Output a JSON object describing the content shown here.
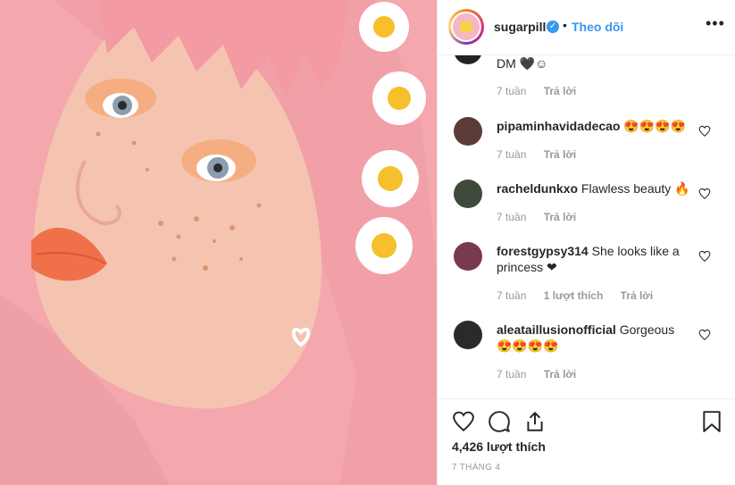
{
  "post": {
    "username": "sugarpill",
    "follow_label": "Theo dõi",
    "separator": "•",
    "verified_icon": "verified-badge-icon",
    "more_icon": "more-options-icon",
    "more_label": "•••",
    "photo_alt": "sugarpill"
  },
  "comments": [
    {
      "user": "",
      "text": "DM 🖤☺",
      "time": "7 tuần",
      "likes": "",
      "reply": "Trả lời",
      "avatar_color": "#222222"
    },
    {
      "user": "pipaminhavidadecao",
      "text": "😍😍😍😍",
      "time": "7 tuần",
      "likes": "",
      "reply": "Trả lời",
      "avatar_color": "#5a3b35"
    },
    {
      "user": "racheldunkxo",
      "text": "Flawless beauty 🔥",
      "time": "7 tuần",
      "likes": "",
      "reply": "Trả lời",
      "avatar_color": "#3f4a3a"
    },
    {
      "user": "forestgypsy314",
      "text": "She looks like a princess ❤",
      "time": "7 tuần",
      "likes": "1 lượt thích",
      "reply": "Trả lời",
      "avatar_color": "#7a3a4e"
    },
    {
      "user": "aleataillusionofficial",
      "text": "Gorgeous 😍😍😍😍",
      "time": "7 tuần",
      "likes": "",
      "reply": "Trả lời",
      "avatar_color": "#2a2a2a"
    }
  ],
  "footer": {
    "like_count": "4,426 lượt thích",
    "date": "7 THÁNG 4",
    "icons": [
      "heart-icon",
      "comment-icon",
      "share-icon",
      "bookmark-icon"
    ]
  },
  "colors": {
    "link": "#3897f0",
    "text": "#262626",
    "muted": "#999999",
    "border": "#efefef"
  }
}
